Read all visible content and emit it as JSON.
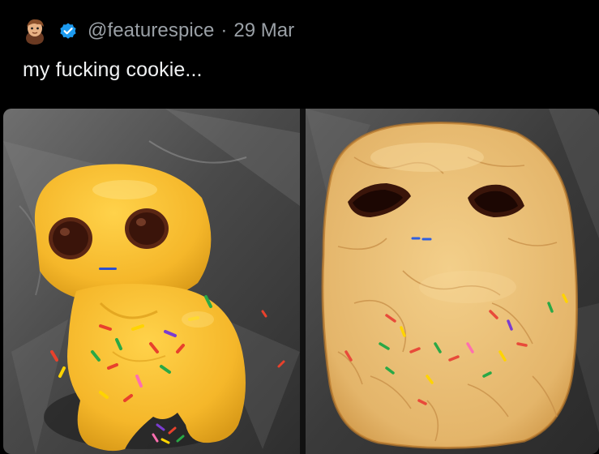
{
  "tweet": {
    "handle": "@featurespice",
    "separator": "·",
    "date": "29 Mar",
    "text": "my fucking cookie...",
    "avatar_icon": "cartoon-avatar-icon",
    "verified_icon": "verified-badge-icon",
    "verified_color": "#1d9bf0",
    "media": [
      {
        "kind": "photo",
        "subject": "raw-cookie-dough-figure",
        "icon": "photo"
      },
      {
        "kind": "photo",
        "subject": "baked-cookie-figure",
        "icon": "photo"
      }
    ]
  }
}
